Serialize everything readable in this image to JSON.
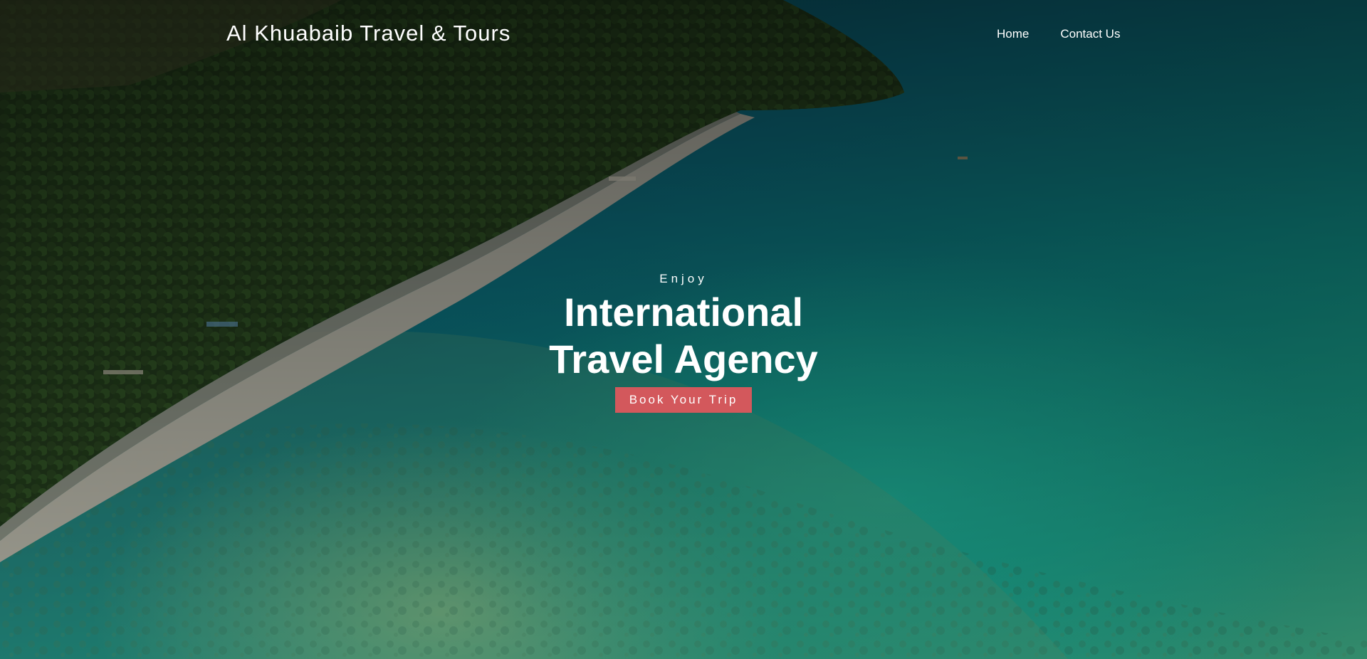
{
  "brand": {
    "name": "Al Khuabaib Travel & Tours"
  },
  "nav": {
    "items": [
      {
        "label": "Home"
      },
      {
        "label": "Contact Us"
      }
    ]
  },
  "hero": {
    "kicker": "Enjoy",
    "headline": "International Travel Agency",
    "cta_label": "Book Your Trip",
    "background_description_icon": "beach-aerial-photo",
    "colors": {
      "cta": "#d3585c",
      "text": "#ffffff",
      "sea": "#0f8f8a",
      "forest": "#1f3a1c",
      "sand": "#b8b2a6"
    }
  }
}
